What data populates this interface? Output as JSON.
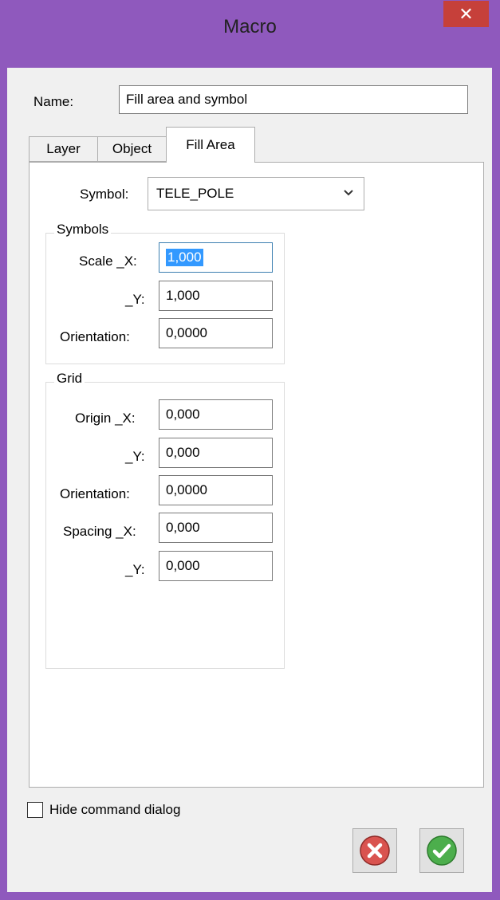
{
  "window": {
    "title": "Macro",
    "close_label": "✕"
  },
  "name": {
    "label": "Name:",
    "value": "Fill area and symbol"
  },
  "tabs": [
    {
      "label": "Layer"
    },
    {
      "label": "Object"
    },
    {
      "label": "Fill Area",
      "active": true
    }
  ],
  "symbol": {
    "label": "Symbol:",
    "value": "TELE_POLE"
  },
  "symbols_group": {
    "title": "Symbols",
    "scale_x_label": "Scale _X:",
    "scale_x_value": "1,000",
    "y_label": "_Y:",
    "y_value": "1,000",
    "orientation_label": "Orientation:",
    "orientation_value": "0,0000"
  },
  "grid_group": {
    "title": "Grid",
    "origin_x_label": "Origin _X:",
    "origin_x_value": "0,000",
    "origin_y_label": "_Y:",
    "origin_y_value": "0,000",
    "orientation_label": "Orientation:",
    "orientation_value": "0,0000",
    "spacing_x_label": "Spacing _X:",
    "spacing_x_value": "0,000",
    "spacing_y_label": "_Y:",
    "spacing_y_value": "0,000"
  },
  "hide_dialog": {
    "label": "Hide command dialog",
    "checked": false
  },
  "colors": {
    "titlebar": "#8f59bd",
    "close": "#c6403a",
    "cancel": "#d9534f",
    "ok": "#4cae4c"
  }
}
